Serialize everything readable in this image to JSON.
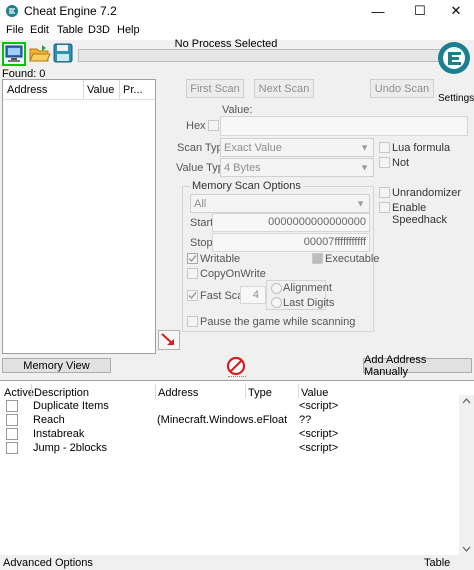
{
  "window": {
    "title": "Cheat Engine 7.2",
    "minimize": "—",
    "maximize": "☐",
    "close": "✕"
  },
  "menu": {
    "items": [
      "File",
      "Edit",
      "Table",
      "D3D",
      "Help"
    ]
  },
  "process": {
    "label": "No Process Selected"
  },
  "found": {
    "label": "Found: 0"
  },
  "logo": {
    "settings_label": "Settings",
    "brand": "Cheat Engine"
  },
  "results": {
    "columns": [
      "Address",
      "Value",
      "Pr..."
    ]
  },
  "scan": {
    "first_scan": "First Scan",
    "next_scan": "Next Scan",
    "undo_scan": "Undo Scan",
    "value_label": "Value:",
    "hex_label": "Hex",
    "scan_type_label": "Scan Type",
    "scan_type_value": "Exact Value",
    "value_type_label": "Value Type",
    "value_type_value": "4 Bytes",
    "lua_formula": "Lua formula",
    "not_label": "Not",
    "unrandomizer": "Unrandomizer",
    "enable_speedhack": "Enable Speedhack"
  },
  "memory_options": {
    "title": "Memory Scan Options",
    "region": "All",
    "start_label": "Start",
    "start_value": "0000000000000000",
    "stop_label": "Stop",
    "stop_value": "00007fffffffffff",
    "writable": "Writable",
    "executable": "Executable",
    "copy_on_write": "CopyOnWrite",
    "fast_scan": "Fast Scan",
    "fast_scan_value": "4",
    "alignment": "Alignment",
    "last_digits": "Last Digits",
    "pause": "Pause the game while scanning"
  },
  "buttons": {
    "memory_view": "Memory View",
    "add_address": "Add Address Manually"
  },
  "address_list": {
    "columns": [
      "Active",
      "Description",
      "Address",
      "Type",
      "Value"
    ],
    "rows": [
      {
        "description": "Duplicate Items",
        "address": "",
        "type": "",
        "value": "<script>"
      },
      {
        "description": "Reach",
        "address": "(Minecraft.Windows.eFloat",
        "type": "",
        "value": "??"
      },
      {
        "description": "Instabreak",
        "address": "",
        "type": "",
        "value": "<script>"
      },
      {
        "description": "Jump - 2blocks",
        "address": "",
        "type": "",
        "value": "<script>"
      }
    ]
  },
  "status": {
    "advanced_options": "Advanced Options",
    "table_extras": "Table Extras"
  },
  "colors": {
    "accent_green": "#00c800",
    "logo_teal": "#1a7f8e",
    "arrow_red": "#d02020"
  }
}
